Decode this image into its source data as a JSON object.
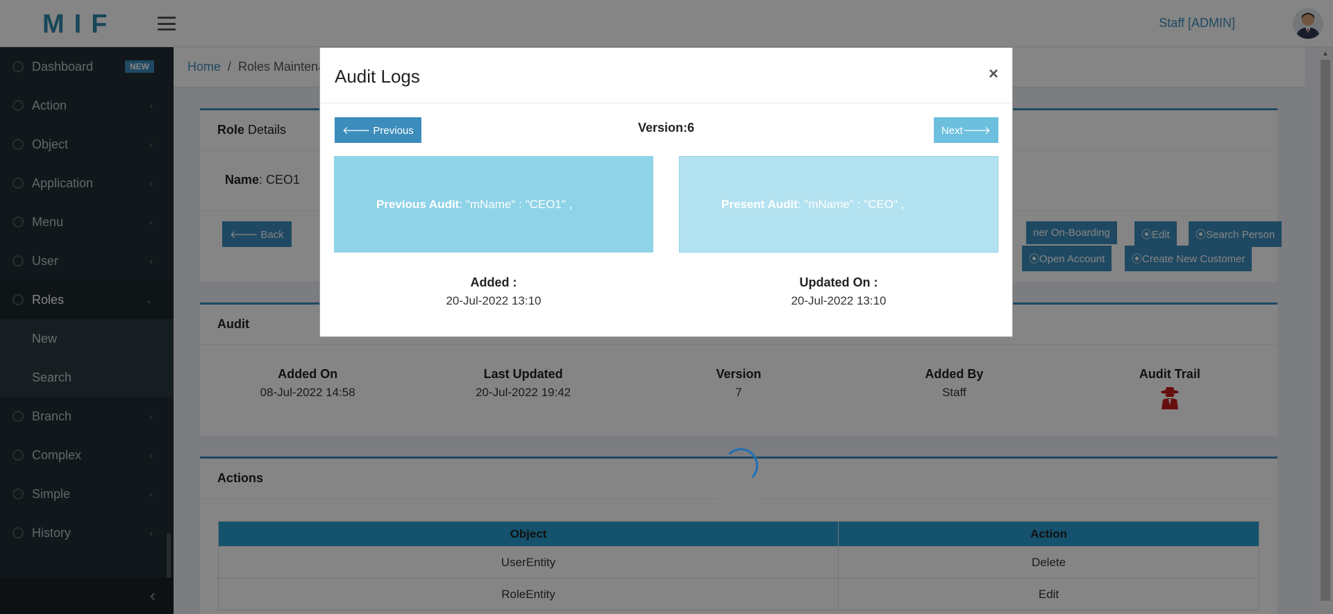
{
  "header": {
    "logo": "MIF",
    "user": "Staff [ADMIN]"
  },
  "sidebar": {
    "items": [
      {
        "label": "Dashboard",
        "badge": "NEW"
      },
      {
        "label": "Action",
        "chevron": "‹"
      },
      {
        "label": "Object",
        "chevron": "‹"
      },
      {
        "label": "Application",
        "chevron": "‹"
      },
      {
        "label": "Menu",
        "chevron": "‹"
      },
      {
        "label": "User",
        "chevron": "‹"
      },
      {
        "label": "Roles",
        "chevron": "⌄"
      }
    ],
    "roles_sub": [
      "New",
      "Search"
    ],
    "items_after": [
      {
        "label": "Branch",
        "chevron": "‹"
      },
      {
        "label": "Complex",
        "chevron": "‹"
      },
      {
        "label": "Simple",
        "chevron": "‹"
      },
      {
        "label": "History",
        "chevron": "‹"
      }
    ],
    "collapse": "‹"
  },
  "breadcrumb": {
    "home": "Home",
    "separator": "/",
    "current": "Roles Maintenance"
  },
  "role_details": {
    "title_bold": "Role",
    "title_rest": "Details",
    "name_label": "Name",
    "name_value": ": CEO1",
    "back_label": "🡐 Back",
    "buttons": [
      "ner On-Boarding",
      "⦿Edit",
      "⦿Search Person",
      "⦿Open Account",
      "⦿Create New Customer"
    ]
  },
  "audit": {
    "title": "Audit",
    "columns": [
      {
        "label": "Added On",
        "value": "08-Jul-2022 14:58"
      },
      {
        "label": "Last Updated",
        "value": "20-Jul-2022 19:42"
      },
      {
        "label": "Version",
        "value": "7"
      },
      {
        "label": "Added By",
        "value": "Staff"
      },
      {
        "label": "Audit Trail",
        "icon": "spy-icon"
      }
    ]
  },
  "actions": {
    "title": "Actions",
    "headers": [
      "Object",
      "Action"
    ],
    "rows": [
      [
        "UserEntity",
        "Delete"
      ],
      [
        "RoleEntity",
        "Edit"
      ]
    ]
  },
  "loading": "Loading..",
  "modal": {
    "title": "Audit Logs",
    "close": "×",
    "prev_label": "🡐 Previous",
    "next_label": "Next🡒",
    "version": "Version:6",
    "previous_audit_label": "Previous Audit",
    "previous_audit_value": ": \"mName\" : \"CEO1\" ,",
    "present_audit_label": "Present Audit",
    "present_audit_value": ": \"mName\" : \"CEO\" ,",
    "added_label": "Added :",
    "added_value": "20-Jul-2022 13:10",
    "updated_label": "Updated On :",
    "updated_value": "20-Jul-2022 13:10"
  }
}
